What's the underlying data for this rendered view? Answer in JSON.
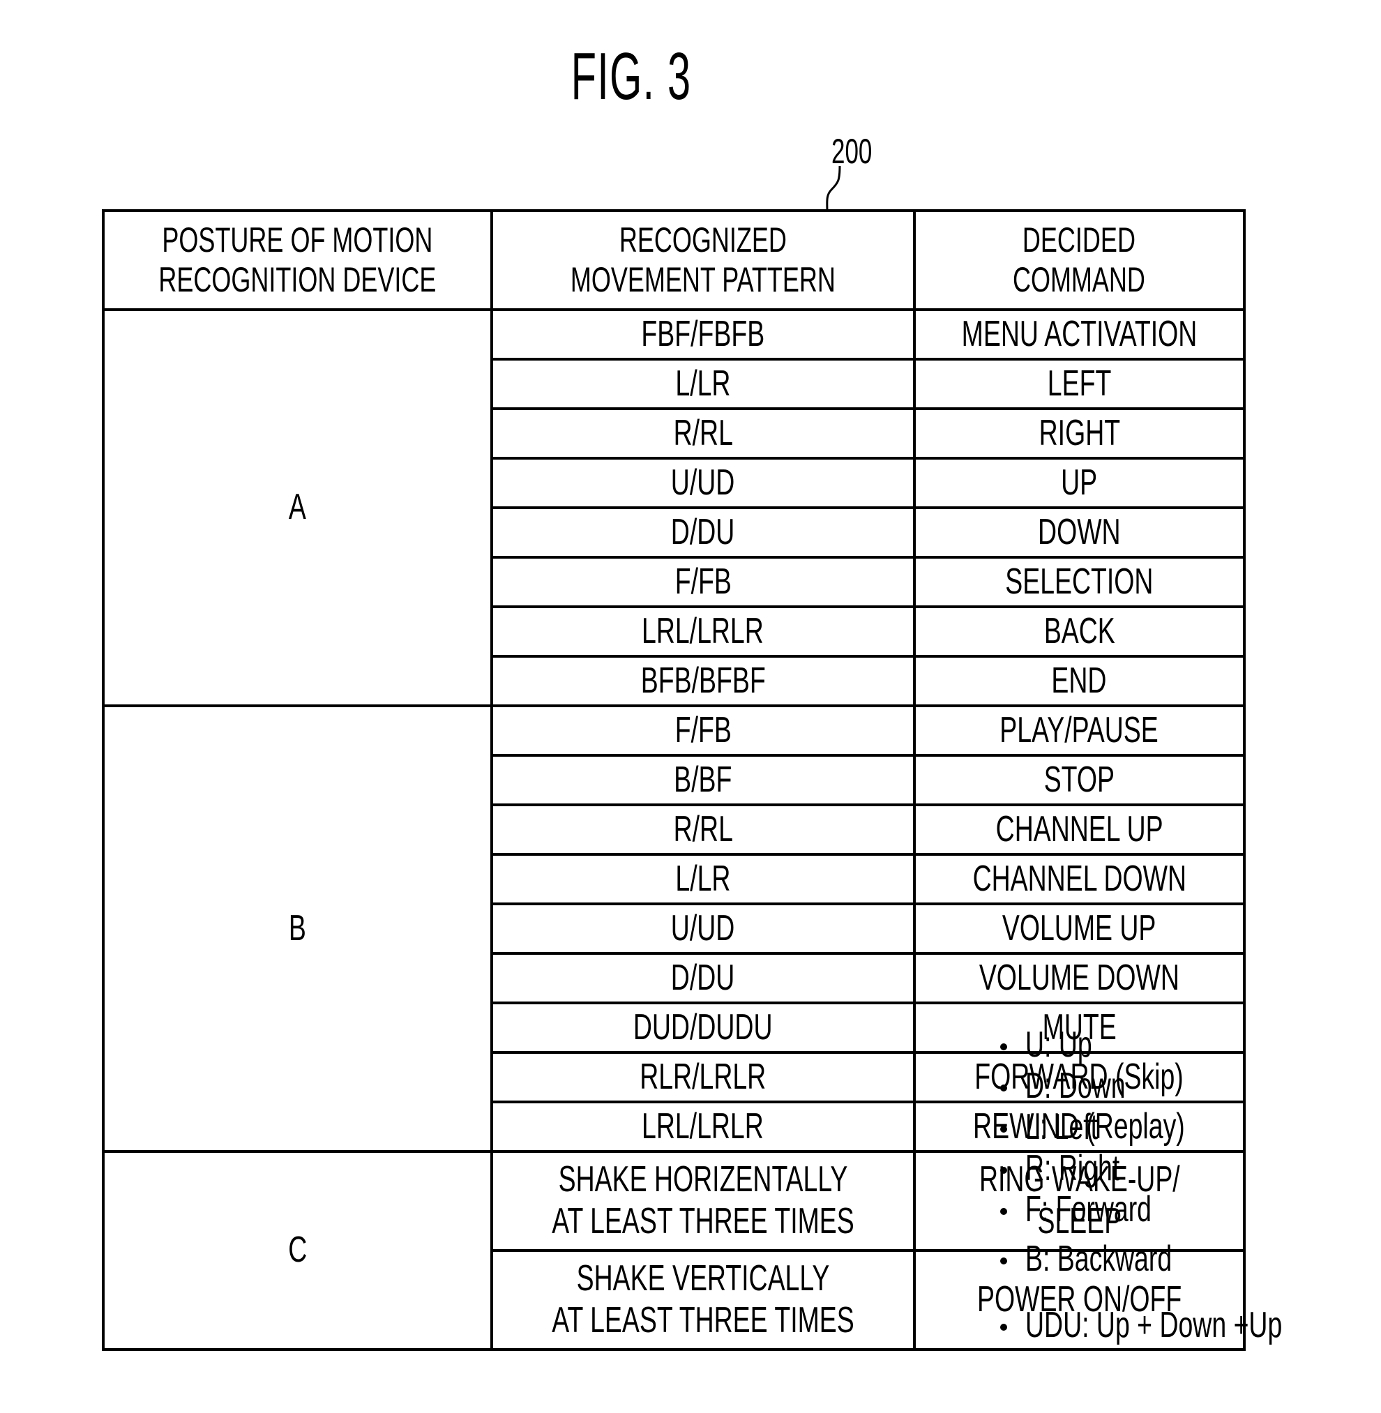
{
  "figure": {
    "title": "FIG. 3",
    "reference_numeral": "200"
  },
  "table": {
    "headers": [
      [
        "POSTURE OF MOTION",
        "RECOGNITION DEVICE"
      ],
      [
        "RECOGNIZED",
        "MOVEMENT PATTERN"
      ],
      [
        "DECIDED",
        "COMMAND"
      ]
    ],
    "groups": [
      {
        "posture": "A",
        "rows": [
          {
            "pattern": [
              "FBF/FBFB"
            ],
            "command": [
              "MENU ACTIVATION"
            ]
          },
          {
            "pattern": [
              "L/LR"
            ],
            "command": [
              "LEFT"
            ]
          },
          {
            "pattern": [
              "R/RL"
            ],
            "command": [
              "RIGHT"
            ]
          },
          {
            "pattern": [
              "U/UD"
            ],
            "command": [
              "UP"
            ]
          },
          {
            "pattern": [
              "D/DU"
            ],
            "command": [
              "DOWN"
            ]
          },
          {
            "pattern": [
              "F/FB"
            ],
            "command": [
              "SELECTION"
            ]
          },
          {
            "pattern": [
              "LRL/LRLR"
            ],
            "command": [
              "BACK"
            ]
          },
          {
            "pattern": [
              "BFB/BFBF"
            ],
            "command": [
              "END"
            ]
          }
        ]
      },
      {
        "posture": "B",
        "rows": [
          {
            "pattern": [
              "F/FB"
            ],
            "command": [
              "PLAY/PAUSE"
            ]
          },
          {
            "pattern": [
              "B/BF"
            ],
            "command": [
              "STOP"
            ]
          },
          {
            "pattern": [
              "R/RL"
            ],
            "command": [
              "CHANNEL UP"
            ]
          },
          {
            "pattern": [
              "L/LR"
            ],
            "command": [
              "CHANNEL DOWN"
            ]
          },
          {
            "pattern": [
              "U/UD"
            ],
            "command": [
              "VOLUME UP"
            ]
          },
          {
            "pattern": [
              "D/DU"
            ],
            "command": [
              "VOLUME DOWN"
            ]
          },
          {
            "pattern": [
              "DUD/DUDU"
            ],
            "command": [
              "MUTE"
            ]
          },
          {
            "pattern": [
              "RLR/LRLR"
            ],
            "command": [
              "FORWARD (Skip)"
            ]
          },
          {
            "pattern": [
              "LRL/LRLR"
            ],
            "command": [
              "REWIND (Replay)"
            ]
          }
        ]
      },
      {
        "posture": "C",
        "rows": [
          {
            "pattern": [
              "SHAKE HORIZENTALLY",
              "AT LEAST THREE TIMES"
            ],
            "command": [
              "RING WAKE-UP/",
              "SLEEP"
            ]
          },
          {
            "pattern": [
              "SHAKE VERTICALLY",
              "AT LEAST THREE TIMES"
            ],
            "command": [
              "POWER ON/OFF"
            ]
          }
        ]
      }
    ]
  },
  "legend": [
    "U: Up",
    "D: Down",
    "L: Left",
    "R: Right",
    "F: Forward",
    "B: Backward",
    "UDU: Up + Down +Up"
  ]
}
